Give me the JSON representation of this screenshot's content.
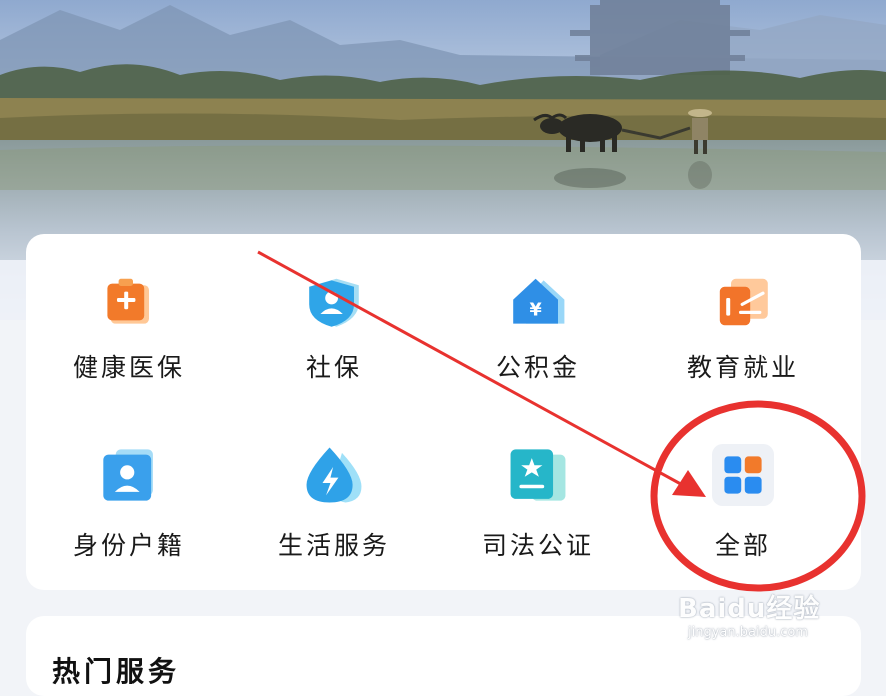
{
  "services": [
    {
      "label": "健康医保",
      "icon": "medical-insurance-icon"
    },
    {
      "label": "社保",
      "icon": "social-security-shield-icon"
    },
    {
      "label": "公积金",
      "icon": "housing-fund-house-icon"
    },
    {
      "label": "教育就业",
      "icon": "education-employment-icon"
    },
    {
      "label": "身份户籍",
      "icon": "identity-card-icon"
    },
    {
      "label": "生活服务",
      "icon": "water-drop-lightning-icon"
    },
    {
      "label": "司法公证",
      "icon": "notary-certificate-icon"
    },
    {
      "label": "全部",
      "icon": "all-grid-icon"
    }
  ],
  "section2": {
    "title": "热门服务"
  },
  "watermark": {
    "brand": "Baidu经验",
    "url": "jingyan.baidu.com"
  },
  "colors": {
    "orange": "#f27a2a",
    "blue": "#3a9cf2",
    "annotation_red": "#e8322f"
  }
}
